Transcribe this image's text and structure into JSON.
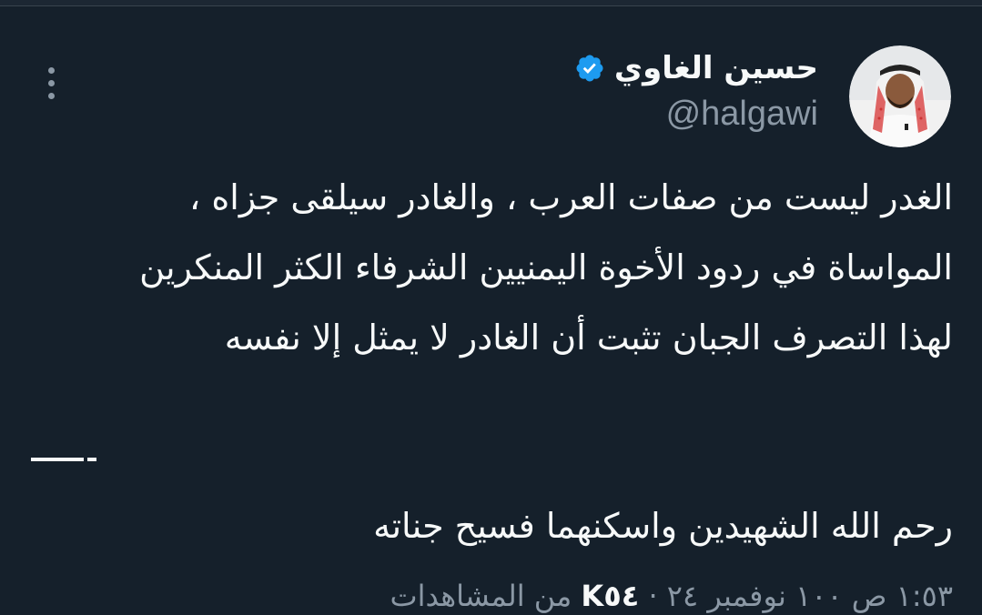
{
  "author": {
    "display_name": "حسين الغاوي",
    "handle": "@halgawi",
    "verified": true,
    "verified_color": "#1d9bf0",
    "avatar": "profile-photo"
  },
  "tweet": {
    "lines": [
      "الغدر ليست من صفات العرب ، والغادر سيلقى جزاه ،",
      "المواساة في ردود الأخوة اليمنيين الشرفاء الكثر المنكرين",
      "لهذا التصرف الجبان تثبت أن الغادر لا يمثل إلا نفسه"
    ],
    "separator": "——-",
    "closing": "رحم الله الشهيدين واسكنهما فسيح جناته"
  },
  "meta": {
    "timestamp": "١:٥٣ ص ١٠٠ نوفمبر ٢٤",
    "dot": "·",
    "views_count": "K٥٤",
    "views_label": "من المشاهدات"
  },
  "icons": {
    "more": "more-horizontal-icon",
    "verified": "verified-badge-icon"
  },
  "colors": {
    "background": "#15202b",
    "text": "#f7f9f9",
    "secondary": "#8b98a5",
    "accent": "#1d9bf0"
  }
}
